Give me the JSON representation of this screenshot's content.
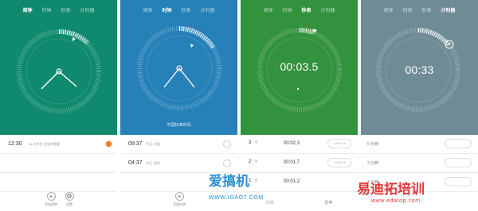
{
  "colors": {
    "alarm": "#108a6e",
    "clock": "#2681b8",
    "stopwatch": "#33923d",
    "timer": "#6f8c96",
    "accent_orange": "#f07a2c"
  },
  "tabs": [
    "闹钟",
    "时钟",
    "秒表",
    "计时器"
  ],
  "alarm": {
    "items": [
      {
        "time": "12:30",
        "sub": "16 小时后 后响铃提醒"
      }
    ],
    "actions": {
      "add_label": "添加闹钟",
      "settings_label": "设置"
    }
  },
  "clock": {
    "caption": "中国标准时间",
    "cities": [
      {
        "time": "09:37",
        "day": "今天",
        "city": "伦敦"
      },
      {
        "time": "04:37",
        "day": "今天",
        "city": "纽约"
      }
    ],
    "actions": {
      "add_label": "添加时钟"
    }
  },
  "stopwatch": {
    "display": "00:03.5",
    "laps": [
      {
        "index": "3",
        "unit": "圈",
        "time": "00:02.3",
        "diff": "+00:00.5"
      },
      {
        "index": "2",
        "unit": "圈",
        "time": "00:01.7",
        "diff": "+00:00.5"
      },
      {
        "index": "1",
        "unit": "圈",
        "time": "00:01.2",
        "diff": ""
      }
    ],
    "actions": {
      "reset_label": "计次",
      "pause_label": "暂停"
    }
  },
  "timer": {
    "display": "00:33",
    "presets": [
      {
        "label": "0 分钟"
      },
      {
        "label": "2 分钟"
      },
      {
        "label": "4 分钟"
      }
    ]
  },
  "watermarks": {
    "left_cn": "爱搞机",
    "left_url": "WWW.IGAO7.COM",
    "right_cn": "易迪拓培训",
    "right_url": "www.edatop.com"
  }
}
